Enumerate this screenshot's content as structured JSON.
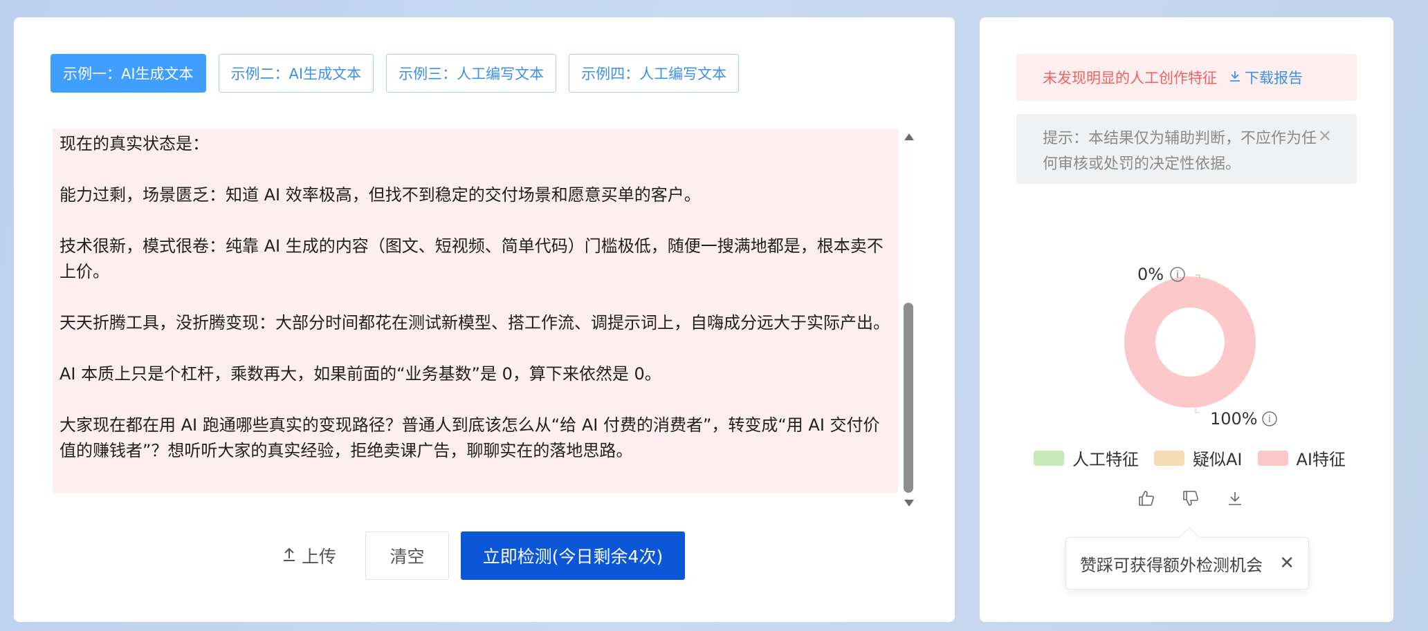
{
  "tabs": [
    {
      "label": "示例一：AI生成文本",
      "active": true
    },
    {
      "label": "示例二：AI生成文本",
      "active": false
    },
    {
      "label": "示例三：人工编写文本",
      "active": false
    },
    {
      "label": "示例四：人工编写文本",
      "active": false
    }
  ],
  "content": {
    "paragraphs": [
      "现在的真实状态是：",
      "能力过剩，场景匮乏：知道 AI 效率极高，但找不到稳定的交付场景和愿意买单的客户。",
      "技术很新，模式很卷：纯靠 AI 生成的内容（图文、短视频、简单代码）门槛极低，随便一搜满地都是，根本卖不上价。",
      "天天折腾工具，没折腾变现：大部分时间都花在测试新模型、搭工作流、调提示词上，自嗨成分远大于实际产出。",
      "AI 本质上只是个杠杆，乘数再大，如果前面的“业务基数”是 0，算下来依然是 0。",
      "大家现在都在用 AI 跑通哪些真实的变现路径？普通人到底该怎么从“给 AI 付费的消费者”，转变成“用 AI 交付价值的赚钱者”？想听听大家的真实经验，拒绝卖课广告，聊聊实在的落地思路。"
    ]
  },
  "actions": {
    "upload_label": "上传",
    "clear_label": "清空",
    "detect_label": "立即检测(今日剩余4次)"
  },
  "result": {
    "banner_text": "未发现明显的人工创作特征",
    "download_label": "下载报告",
    "tip_text": "提示：本结果仅为辅助判断，不应作为任何审核或处罚的决定性依据。"
  },
  "chart_data": {
    "type": "pie",
    "labels": [
      "人工特征",
      "疑似AI",
      "AI特征"
    ],
    "values": [
      0,
      0,
      100
    ],
    "value_labels": [
      "0%",
      "100%"
    ],
    "colors": [
      "#c8eab9",
      "#f6dcb4",
      "#fcc8c9"
    ],
    "legend_position": "bottom"
  },
  "toast": {
    "text": "赞踩可获得额外检测机会"
  }
}
